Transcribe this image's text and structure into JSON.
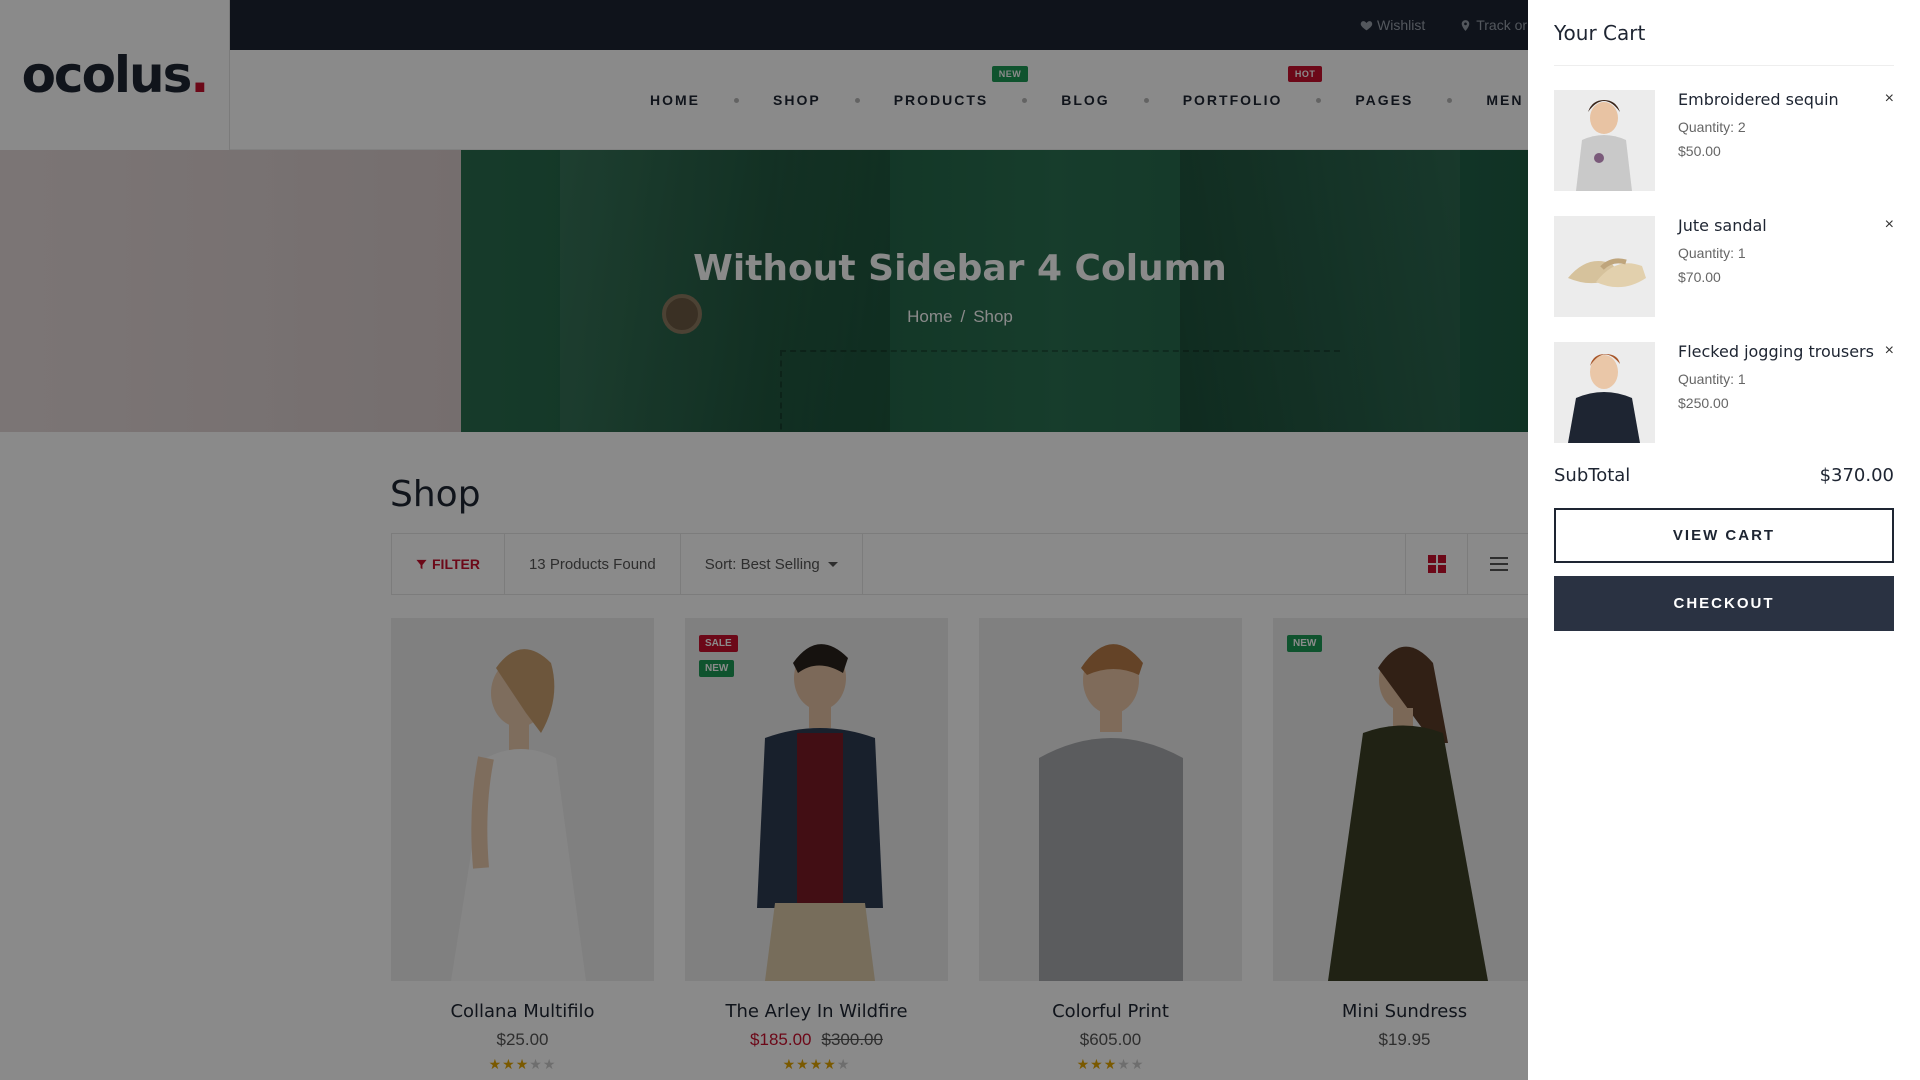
{
  "topbar": {
    "links": [
      {
        "label": "Wishlist",
        "icon": "heart-icon"
      },
      {
        "label": "Track or",
        "icon": "map-pin-icon"
      }
    ]
  },
  "logo": {
    "text": "ocolus",
    "dot": "."
  },
  "nav": {
    "items": [
      {
        "label": "HOME",
        "badge": ""
      },
      {
        "label": "SHOP",
        "badge": ""
      },
      {
        "label": "PRODUCTS",
        "badge": "NEW"
      },
      {
        "label": "BLOG",
        "badge": ""
      },
      {
        "label": "PORTFOLIO",
        "badge": "HOT"
      },
      {
        "label": "PAGES",
        "badge": ""
      },
      {
        "label": "MEN",
        "badge": ""
      }
    ]
  },
  "hero": {
    "title": "Without Sidebar 4 Column",
    "breadcrumb": [
      "Home",
      "/",
      "Shop"
    ]
  },
  "shop": {
    "title": "Shop",
    "filter_label": "FILTER",
    "count_label": "13 Products Found",
    "sort_label": "Sort: Best Selling"
  },
  "products": [
    {
      "name": "Collana Multifilo",
      "price": "$25.00",
      "old_price": "",
      "badges": [],
      "rating": 3
    },
    {
      "name": "The Arley In Wildfire",
      "price": "$185.00",
      "old_price": "$300.00",
      "badges": [
        "SALE",
        "NEW"
      ],
      "rating": 4
    },
    {
      "name": "Colorful Print",
      "price": "$605.00",
      "old_price": "",
      "badges": [],
      "rating": 3
    },
    {
      "name": "Mini Sundress",
      "price": "$19.95",
      "old_price": "",
      "badges": [
        "NEW"
      ],
      "rating": 0
    }
  ],
  "cart": {
    "title": "Your Cart",
    "items": [
      {
        "name": "Embroidered sequin",
        "quantity": "Quantity: 2",
        "price": "$50.00"
      },
      {
        "name": "Jute sandal",
        "quantity": "Quantity: 1",
        "price": "$70.00"
      },
      {
        "name": "Flecked jogging trousers",
        "quantity": "Quantity: 1",
        "price": "$250.00"
      }
    ],
    "remove_symbol": "×",
    "subtotal_label": "SubTotal",
    "subtotal_value": "$370.00",
    "view_cart_label": "VIEW CART",
    "checkout_label": "CHECKOUT"
  },
  "colors": {
    "accent": "#c8102e",
    "dark": "#1e2532",
    "topbar": "#1c2433",
    "badge_green": "#1d9a56",
    "star": "#e2a400"
  }
}
